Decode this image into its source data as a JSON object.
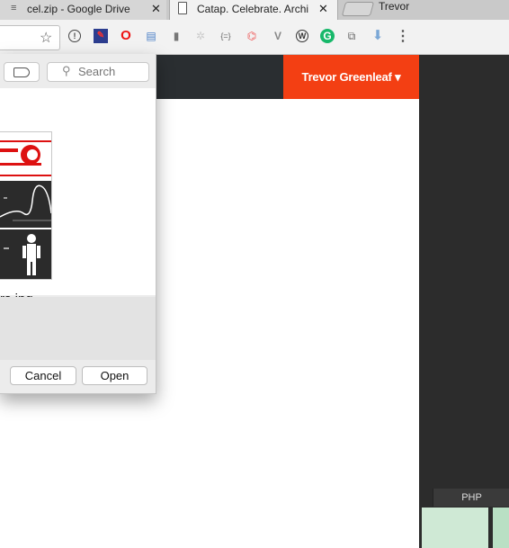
{
  "browser": {
    "tabs": [
      {
        "title": "cel.zip - Google Drive",
        "close": "✕"
      },
      {
        "title": "Catap. Celebrate. Archi",
        "close": "✕"
      }
    ],
    "profile_name": "Trevor",
    "star_icon": "star-icon",
    "menu_icon": "⋮"
  },
  "site": {
    "user_menu_label": "Trevor Greenleaf",
    "user_menu_caret": "▾",
    "accent_color": "#f33f13",
    "header_color": "#2a2e31"
  },
  "background_app": {
    "tab_label": "PHP"
  },
  "dialog": {
    "search_placeholder": "Search",
    "file_name": "rs.jpg",
    "cancel_label": "Cancel",
    "open_label": "Open"
  }
}
